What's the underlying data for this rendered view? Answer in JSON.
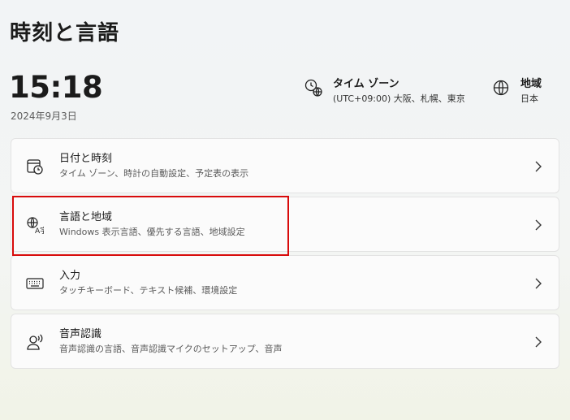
{
  "page": {
    "title": "時刻と言語"
  },
  "clock": {
    "time": "15:18",
    "date": "2024年9月3日"
  },
  "timezone": {
    "label": "タイム ゾーン",
    "value": "(UTC+09:00) 大阪、札幌、東京",
    "icon": "clock-globe-icon"
  },
  "region": {
    "label": "地域",
    "value": "日本",
    "icon": "globe-icon"
  },
  "cards": [
    {
      "title": "日付と時刻",
      "subtitle": "タイム ゾーン、時計の自動設定、予定表の表示",
      "icon": "calendar-clock-icon"
    },
    {
      "title": "言語と地域",
      "subtitle": "Windows 表示言語、優先する言語、地域設定",
      "icon": "language-icon"
    },
    {
      "title": "入力",
      "subtitle": "タッチキーボード、テキスト候補、環境設定",
      "icon": "keyboard-icon"
    },
    {
      "title": "音声認識",
      "subtitle": "音声認識の言語、音声認識マイクのセットアップ、音声",
      "icon": "speech-icon"
    }
  ],
  "colors": {
    "highlight": "#d80b0b",
    "background": "#f2f4f6",
    "card": "#fbfbfb"
  }
}
